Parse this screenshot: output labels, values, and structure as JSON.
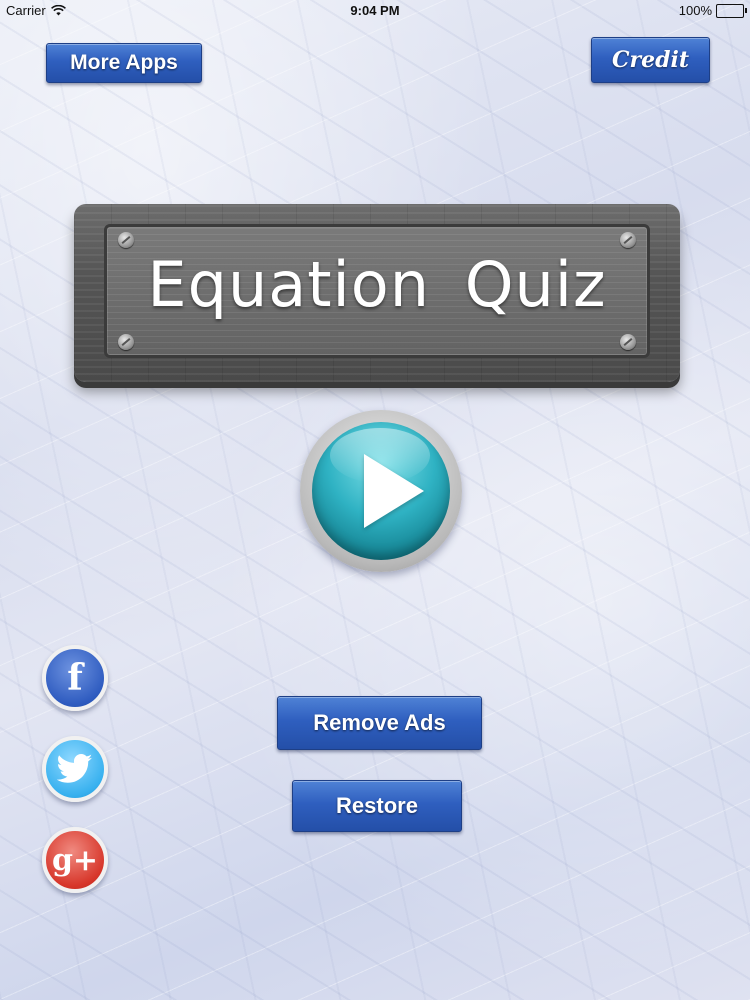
{
  "status_bar": {
    "carrier": "Carrier",
    "time": "9:04 PM",
    "battery": "100%"
  },
  "top": {
    "more_apps": "More Apps",
    "credit": "Credit"
  },
  "sign": {
    "title": "Equation Quiz"
  },
  "buttons": {
    "remove_ads": "Remove Ads",
    "restore": "Restore"
  },
  "social": {
    "facebook": "f",
    "google_plus": "g+"
  },
  "colors": {
    "button_blue": "#2f5fbf",
    "play_teal": "#2fb2c3",
    "facebook": "#2f5cc0",
    "twitter": "#38b1ef",
    "google_plus": "#d7362a"
  }
}
